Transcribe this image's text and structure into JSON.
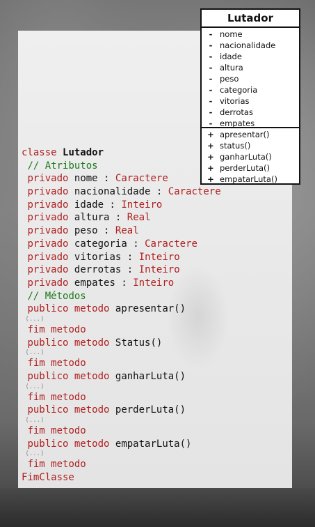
{
  "uml": {
    "title": "Lutador",
    "attribute_symbol": "-",
    "method_symbol": "+",
    "attributes": [
      "nome",
      "nacionalidade",
      "idade",
      "altura",
      "peso",
      "categoria",
      "vitorias",
      "derrotas",
      "empates"
    ],
    "methods": [
      "apresentar()",
      "status()",
      "ganharLuta()",
      "perderLuta()",
      "empatarLuta()"
    ]
  },
  "code": {
    "class_kw": "classe",
    "class_name": "Lutador",
    "comment_attrs": "// Atributos",
    "private_kw": "privado",
    "colon": ":",
    "attributes": [
      {
        "name": "nome",
        "type": "Caractere"
      },
      {
        "name": "nacionalidade",
        "type": "Caractere"
      },
      {
        "name": "idade",
        "type": "Inteiro"
      },
      {
        "name": "altura",
        "type": "Real"
      },
      {
        "name": "peso",
        "type": "Real"
      },
      {
        "name": "categoria",
        "type": "Caractere"
      },
      {
        "name": "vitorias",
        "type": "Inteiro"
      },
      {
        "name": "derrotas",
        "type": "Inteiro"
      },
      {
        "name": "empates",
        "type": "Inteiro"
      }
    ],
    "comment_methods": "// Métodos",
    "public_method_kw": "publico metodo",
    "ellipsis": "(...)",
    "end_method": "fim metodo",
    "methods": [
      "apresentar()",
      "Status()",
      "ganharLuta()",
      "perderLuta()",
      "empatarLuta()"
    ],
    "end_class": "FimClasse"
  }
}
